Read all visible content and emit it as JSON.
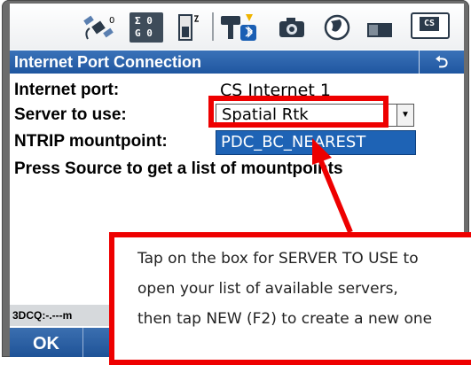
{
  "status_icons": {
    "satellite": "satellite-icon",
    "sv_top": "Σ 0",
    "sv_bottom": "G 0",
    "battery": "battery-icon",
    "receiver_bluetooth": "receiver-bluetooth-icon",
    "camera": "camera-icon",
    "globe": "globe-icon",
    "memory": "memory-card-icon",
    "cs_label": "CS"
  },
  "title_bar": {
    "title": "Internet Port Connection",
    "back_symbol": "⮌"
  },
  "form": {
    "internet_port_label": "Internet port:",
    "internet_port_value": "CS Internet 1",
    "server_label": "Server to use:",
    "server_value": "Spatial Rtk",
    "mountpoint_label": "NTRIP mountpoint:",
    "mountpoint_value": "PDC_BC_NEAREST",
    "hint": "Press Source to get a list of mountpoints"
  },
  "status_line": {
    "text": "3DCQ:-.---m"
  },
  "softkeys": {
    "ok_label": "OK"
  },
  "callout": {
    "lines": [
      "Tap on the box for SERVER TO USE to",
      "open your list of available servers,",
      "then tap NEW (F2) to create a new one"
    ]
  },
  "colors": {
    "title_bar": "#1f56a0",
    "highlight": "#1e63b5",
    "annotation": "#ee0000"
  }
}
